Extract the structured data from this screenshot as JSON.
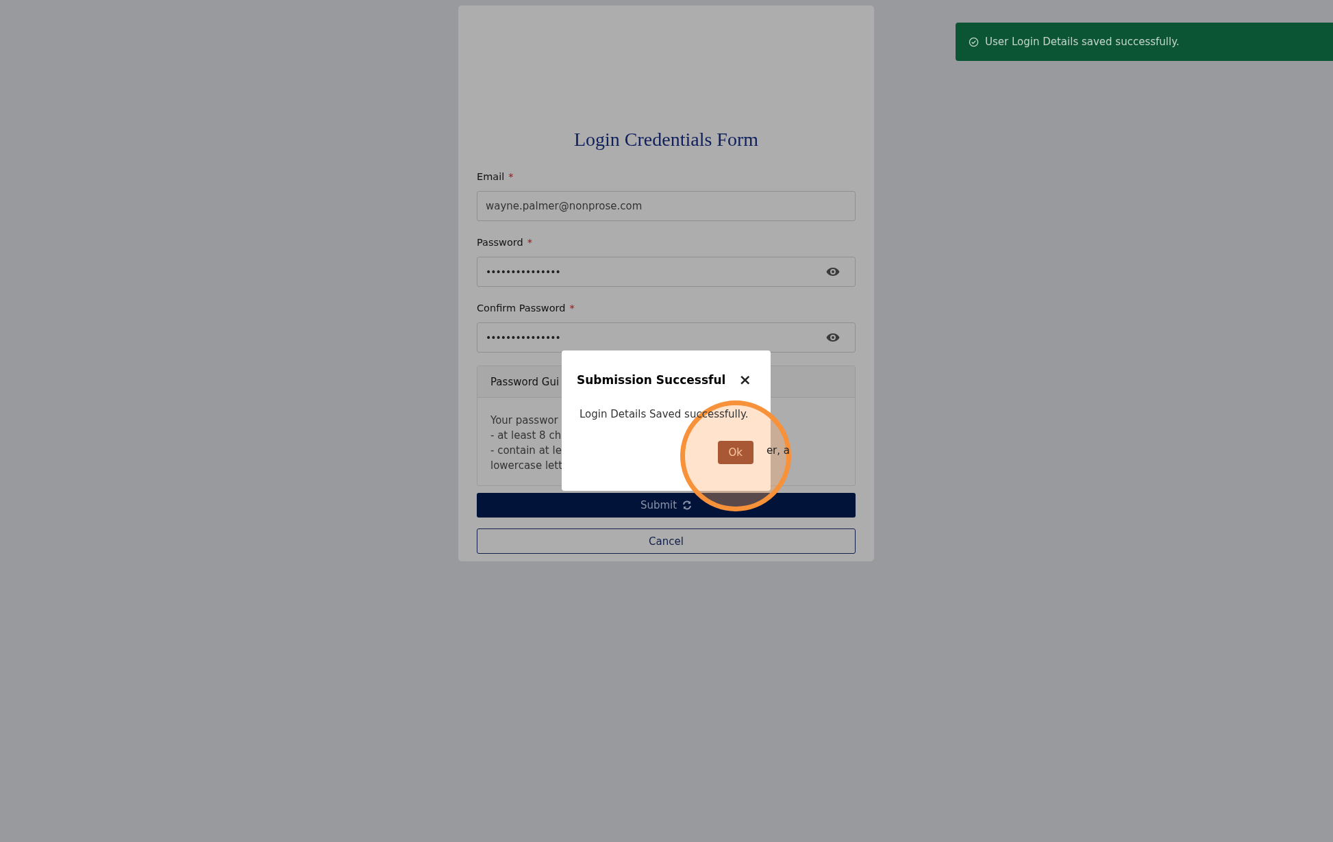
{
  "form": {
    "title": "Login Credentials Form",
    "required_mark": "*",
    "fields": [
      {
        "kind": "text",
        "label": "Email",
        "required": true,
        "value": "wayne.palmer@nonprose.com"
      },
      {
        "kind": "password",
        "label": "Password",
        "required": true,
        "value": "•••••••••••••••"
      },
      {
        "kind": "password",
        "label": "Confirm Password",
        "required": true,
        "value": "•••••••••••••••"
      }
    ],
    "guidelines": {
      "title": "Password Gui",
      "lines": [
        {
          "left": "Your passwor"
        },
        {
          "left": "- at least 8 ch"
        },
        {
          "left": "- contain at le",
          "right": "er, a"
        },
        {
          "left": "lowercase lett"
        }
      ]
    },
    "submit": {
      "label": "Submit",
      "loading": true
    },
    "cancel": {
      "label": "Cancel"
    }
  },
  "dialog": {
    "title": "Submission Successful",
    "close": "×",
    "message": "Login Details Saved successfully.",
    "ok": "Ok"
  },
  "toast": {
    "kind": "success",
    "message": "User Login Details saved successfully."
  }
}
